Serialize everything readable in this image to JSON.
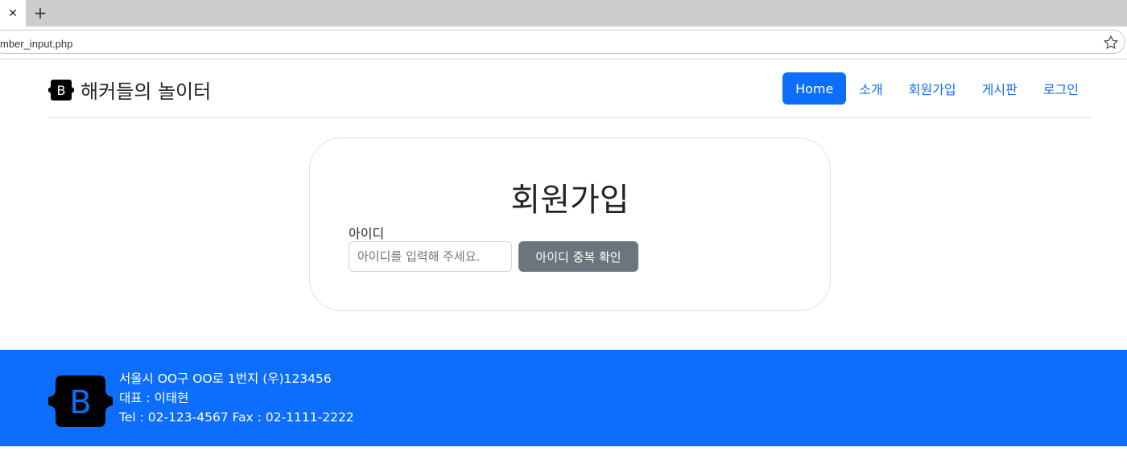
{
  "browser": {
    "tab_close_glyph": "✕",
    "new_tab_glyph": "+",
    "url": "mber_input.php",
    "star_icon": "star-icon"
  },
  "navbar": {
    "brand_letter": "B",
    "brand_text": "해커들의 놀이터",
    "items": [
      {
        "label": "Home",
        "active": true
      },
      {
        "label": "소개",
        "active": false
      },
      {
        "label": "회원가입",
        "active": false
      },
      {
        "label": "게시판",
        "active": false
      },
      {
        "label": "로그인",
        "active": false
      }
    ]
  },
  "form": {
    "title": "회원가입",
    "id_label": "아이디",
    "id_value": "",
    "id_placeholder": "아이디를 입력해 주세요.",
    "check_button": "아이디 중복 확인"
  },
  "footer": {
    "logo_letter": "B",
    "address": "서울시 OO구 OO로 1번지 (우)123456",
    "ceo": "대표 : 이태현",
    "contact": "Tel : 02-123-4567 Fax : 02-1111-2222"
  },
  "colors": {
    "primary": "#0d6efd",
    "secondary": "#6c757d",
    "text": "#212529"
  }
}
